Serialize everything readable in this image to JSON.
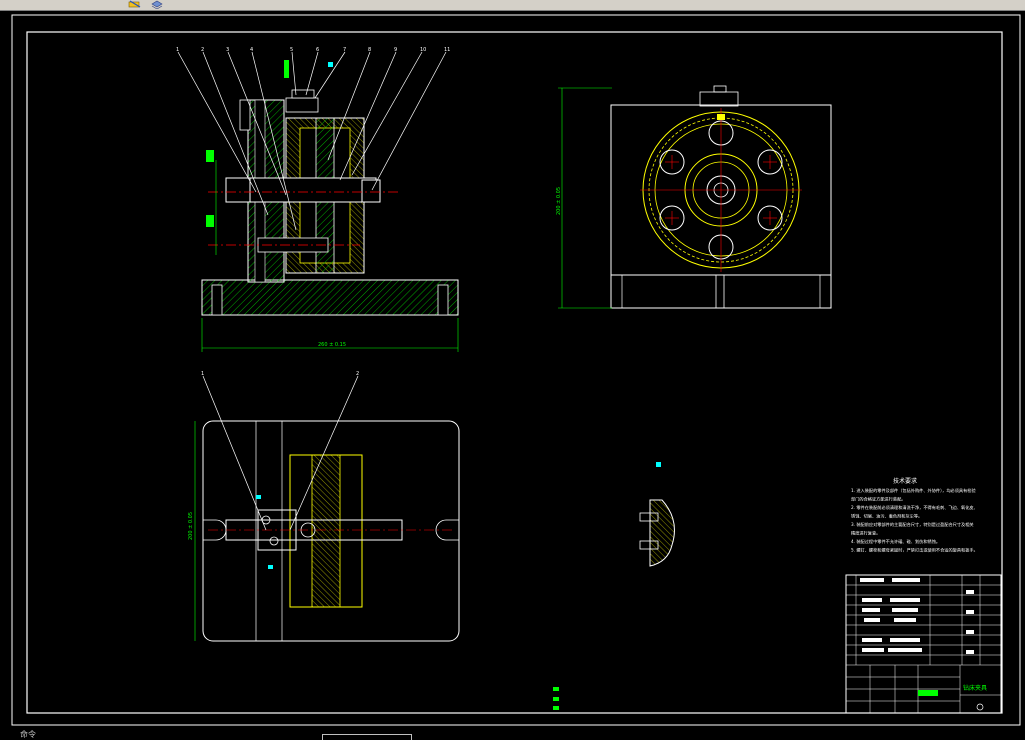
{
  "toolbar": {
    "icons": [
      "pencil-icon",
      "layers-icon"
    ]
  },
  "drawing": {
    "balloon_labels_front": [
      "1",
      "2",
      "3",
      "4",
      "5",
      "6",
      "7",
      "8",
      "9",
      "10",
      "11"
    ],
    "balloon_labels_plan": [
      "1",
      "2"
    ],
    "dim_overall_width": "260 ± 0.15",
    "dim_side_height": "200 ± 0.05",
    "dim_plan_height": "200 ± 0.05",
    "tech_req_title": "技术要求",
    "tech_req_lines": [
      "1. 进入装配的零件及部件（包括外购件、外协件），均必须具有检验",
      "部门的合格证方能进行装配。",
      "2. 零件在装配前必须清理和清洗干净，不得有毛刺、飞边、氧化皮、",
      "锈蚀、切屑、油污、着色剂和灰尘等。",
      "3. 装配前应对零部件的主要配合尺寸，特别是过盈配合尺寸及相关",
      "精度进行复查。",
      "4. 装配过程中零件不允许磕、碰、划伤和锈蚀。",
      "5. 螺钉、螺栓和螺母紧固时，严禁打击或使用不合适的旋具和扳手。"
    ],
    "title_block_name": "钻床夹具",
    "colors": {
      "background": "#000000",
      "outline": "#ffffff",
      "hatch": "#00ff00",
      "dimension": "#00ff00",
      "centerline": "#ff0000",
      "gear": "#ffff00",
      "annotation": "#00ffff"
    }
  },
  "status": {
    "command_prefix": "命令"
  }
}
